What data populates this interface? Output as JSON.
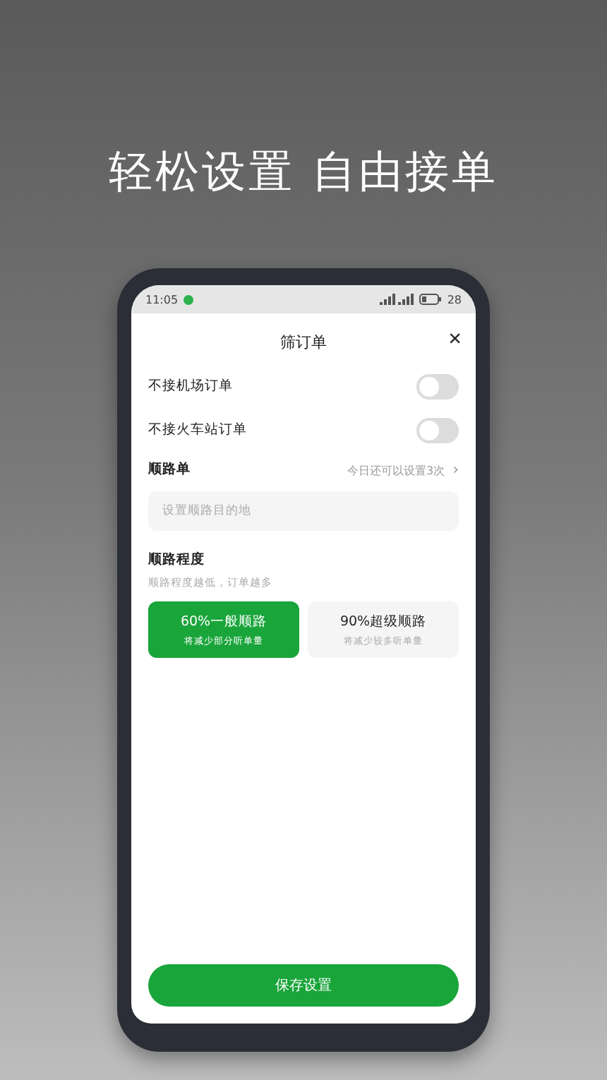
{
  "headline": "轻松设置 自由接单",
  "status_bar": {
    "time": "11:05",
    "battery": "28"
  },
  "dialog": {
    "title": "筛订单",
    "close": "×"
  },
  "toggles": [
    {
      "label": "不接机场订单",
      "on": false
    },
    {
      "label": "不接火车站订单",
      "on": false
    }
  ],
  "route": {
    "label": "顺路单",
    "hint": "今日还可以设置3次",
    "chevron": "›",
    "placeholder": "设置顺路目的地"
  },
  "degree": {
    "label": "顺路程度",
    "note": "顺路程度越低，订单越多",
    "options": [
      {
        "title": "60%一般顺路",
        "sub": "将减少部分听单量",
        "selected": true
      },
      {
        "title": "90%超级顺路",
        "sub": "将减少较多听单量",
        "selected": false
      }
    ]
  },
  "save_button": "保存设置"
}
